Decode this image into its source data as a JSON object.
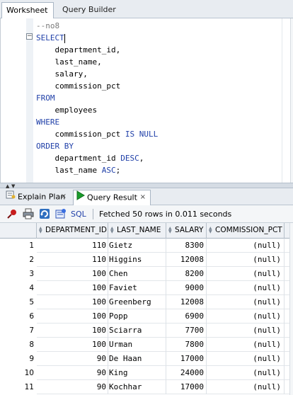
{
  "top_tabs": {
    "worksheet": "Worksheet",
    "query_builder": "Query Builder"
  },
  "editor": {
    "lines": [
      {
        "kind": "comment",
        "text": "--no8"
      },
      {
        "kind": "keyword",
        "text": "SELECT"
      },
      {
        "kind": "plain",
        "text": "department_id,"
      },
      {
        "kind": "plain",
        "text": "last_name,"
      },
      {
        "kind": "plain",
        "text": "salary,"
      },
      {
        "kind": "plain",
        "text": "commission_pct"
      },
      {
        "kind": "keyword",
        "text": "FROM"
      },
      {
        "kind": "plain",
        "text": "employees"
      },
      {
        "kind": "keyword",
        "text": "WHERE"
      },
      {
        "kind": "mixed",
        "text": "commission_pct",
        "kw": "IS NULL"
      },
      {
        "kind": "keyword",
        "text": "ORDER BY"
      },
      {
        "kind": "mixed",
        "text": "department_id",
        "kw": "DESC",
        "tail": ","
      },
      {
        "kind": "mixed",
        "text": "last_name",
        "kw": "ASC",
        "tail": ";"
      }
    ]
  },
  "bottom_tabs": {
    "explain_plan": "Explain Plan",
    "query_result": "Query Result",
    "close_glyph": "×"
  },
  "toolbar": {
    "sql_label": "SQL",
    "separator": "|",
    "status": "Fetched 50 rows in 0.011 seconds"
  },
  "grid": {
    "columns": [
      "DEPARTMENT_ID",
      "LAST_NAME",
      "SALARY",
      "COMMISSION_PCT"
    ],
    "rows": [
      {
        "n": "1",
        "dept": "110",
        "name": "Gietz",
        "salary": "8300",
        "comm": "(null)"
      },
      {
        "n": "2",
        "dept": "110",
        "name": "Higgins",
        "salary": "12008",
        "comm": "(null)"
      },
      {
        "n": "3",
        "dept": "100",
        "name": "Chen",
        "salary": "8200",
        "comm": "(null)"
      },
      {
        "n": "4",
        "dept": "100",
        "name": "Faviet",
        "salary": "9000",
        "comm": "(null)"
      },
      {
        "n": "5",
        "dept": "100",
        "name": "Greenberg",
        "salary": "12008",
        "comm": "(null)"
      },
      {
        "n": "6",
        "dept": "100",
        "name": "Popp",
        "salary": "6900",
        "comm": "(null)"
      },
      {
        "n": "7",
        "dept": "100",
        "name": "Sciarra",
        "salary": "7700",
        "comm": "(null)"
      },
      {
        "n": "8",
        "dept": "100",
        "name": "Urman",
        "salary": "7800",
        "comm": "(null)"
      },
      {
        "n": "9",
        "dept": "90",
        "name": "De Haan",
        "salary": "17000",
        "comm": "(null)"
      },
      {
        "n": "10",
        "dept": "90",
        "name": "King",
        "salary": "24000",
        "comm": "(null)"
      },
      {
        "n": "11",
        "dept": "90",
        "name": "Kochhar",
        "salary": "17000",
        "comm": "(null)"
      }
    ]
  },
  "colors": {
    "keyword": "#1f3fa8",
    "comment": "#7a7a7a",
    "accent_green": "#1a9c2b",
    "pin_red": "#c81e1e"
  }
}
